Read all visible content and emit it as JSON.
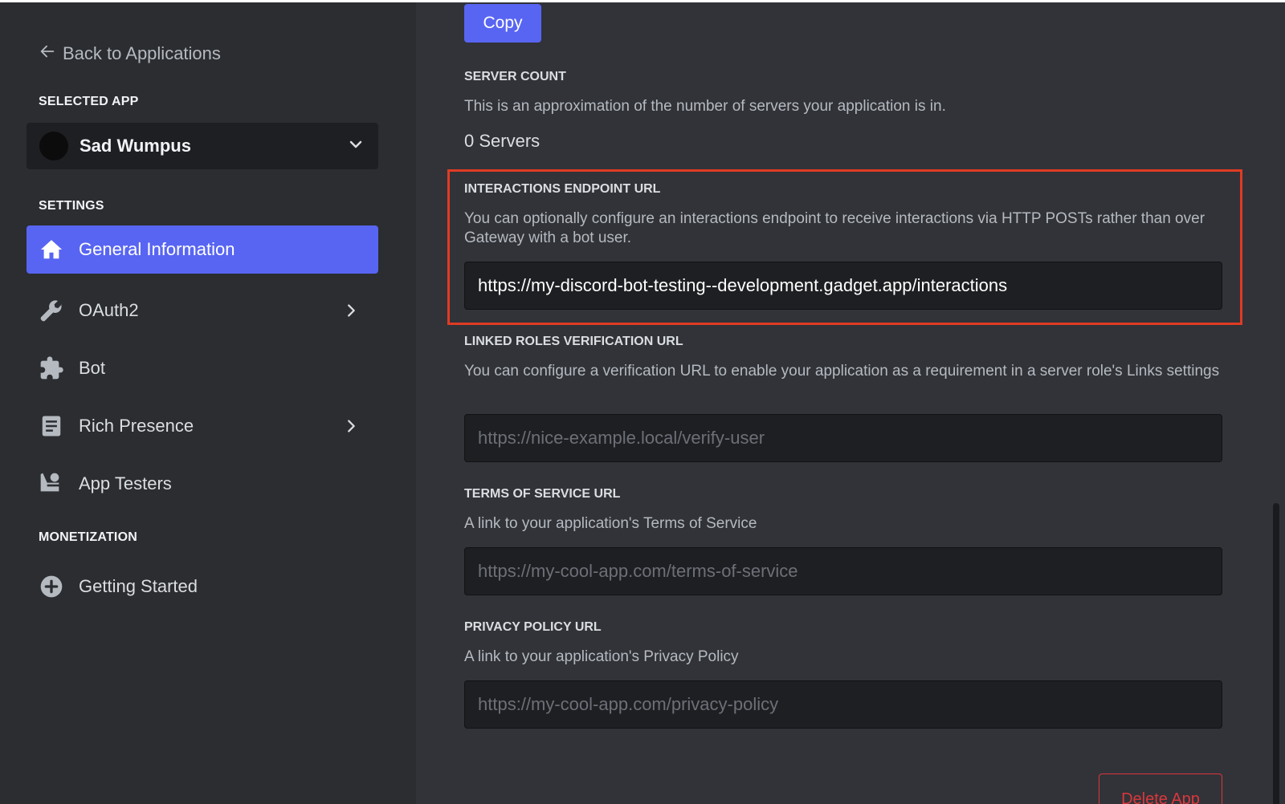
{
  "sidebar": {
    "back_label": "Back to Applications",
    "selected_app_title": "SELECTED APP",
    "selected_app_name": "Sad Wumpus",
    "settings_title": "SETTINGS",
    "nav_items": [
      {
        "label": "General Information",
        "icon": "home-icon",
        "active": true
      },
      {
        "label": "OAuth2",
        "icon": "wrench-icon",
        "has_chevron": true
      },
      {
        "label": "Bot",
        "icon": "puzzle-piece-icon"
      },
      {
        "label": "Rich Presence",
        "icon": "document-icon",
        "has_chevron": true
      },
      {
        "label": "App Testers",
        "icon": "person-icon"
      }
    ],
    "monetization_title": "MONETIZATION",
    "monetization_items": [
      {
        "label": "Getting Started",
        "icon": "plus-circle-icon"
      }
    ]
  },
  "main": {
    "copy_label": "Copy",
    "server_count": {
      "label": "SERVER COUNT",
      "description": "This is an approximation of the number of servers your application is in.",
      "value": "0 Servers"
    },
    "interactions": {
      "label": "INTERACTIONS ENDPOINT URL",
      "description": "You can optionally configure an interactions endpoint to receive interactions via HTTP POSTs rather than over Gateway with a bot user.",
      "value": "https://my-discord-bot-testing--development.gadget.app/interactions"
    },
    "linked_roles": {
      "label": "LINKED ROLES VERIFICATION URL",
      "description": "You can configure a verification URL to enable your application as a requirement in a server role's Links settings",
      "placeholder": "https://nice-example.local/verify-user"
    },
    "terms": {
      "label": "TERMS OF SERVICE URL",
      "description": "A link to your application's Terms of Service",
      "placeholder": "https://my-cool-app.com/terms-of-service"
    },
    "privacy": {
      "label": "PRIVACY POLICY URL",
      "description": "A link to your application's Privacy Policy",
      "placeholder": "https://my-cool-app.com/privacy-policy"
    },
    "delete_label": "Delete App"
  },
  "colors": {
    "accent": "#5865f2",
    "sidebar_bg": "#2b2d31",
    "main_bg": "#313338",
    "input_bg": "#1e1f22",
    "highlight": "#e03b24",
    "danger": "#da373c"
  }
}
